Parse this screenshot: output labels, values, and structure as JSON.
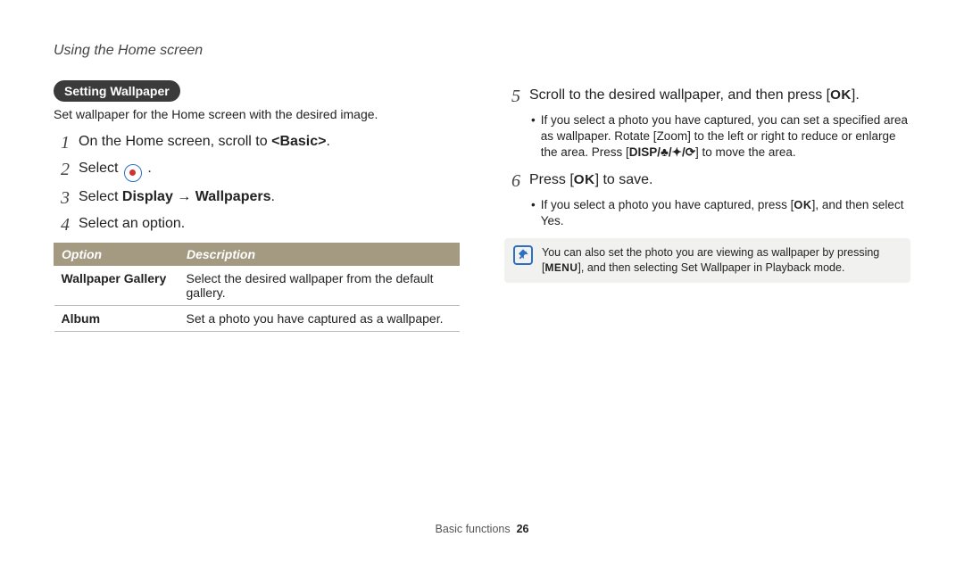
{
  "running_head": "Using the Home screen",
  "section_pill": "Setting Wallpaper",
  "intro": "Set wallpaper for the Home screen with the desired image.",
  "steps_left": {
    "s1_num": "1",
    "s1_a": "On the Home screen, scroll to ",
    "s1_b": "<Basic>",
    "s1_c": ".",
    "s2_num": "2",
    "s2_a": "Select ",
    "s2_b": " .",
    "s3_num": "3",
    "s3_a": "Select ",
    "s3_b": "Display",
    "s3_c": " → ",
    "s3_d": "Wallpapers",
    "s3_e": ".",
    "s4_num": "4",
    "s4_a": "Select an option."
  },
  "table": {
    "h1": "Option",
    "h2": "Description",
    "r1c1": "Wallpaper Gallery",
    "r1c2": "Select the desired wallpaper from the default gallery.",
    "r2c1": "Album",
    "r2c2": "Set a photo you have captured as a wallpaper."
  },
  "steps_right": {
    "s5_num": "5",
    "s5_a": "Scroll to the desired wallpaper, and then press [",
    "s5_ok": "OK",
    "s5_b": "].",
    "s5_bul1_a": "If you select a photo you have captured, you can set a specified area as wallpaper. Rotate [",
    "s5_bul1_zoom": "Zoom",
    "s5_bul1_b": "] to the left or right to reduce or enlarge the area. Press [",
    "s5_bul1_keys": "DISP/♣/✦/⟳",
    "s5_bul1_c": "] to move the area.",
    "s6_num": "6",
    "s6_a": "Press [",
    "s6_ok": "OK",
    "s6_b": "] to save.",
    "s6_bul1_a": "If you select a photo you have captured, press [",
    "s6_bul1_ok": "OK",
    "s6_bul1_b": "], and then select ",
    "s6_bul1_yes": "Yes",
    "s6_bul1_c": "."
  },
  "note": {
    "a": "You can also set the photo you are viewing as wallpaper by pressing [",
    "menu": "MENU",
    "b": "], and then selecting ",
    "setwp": "Set Wallpaper",
    "c": " in Playback mode."
  },
  "footer": {
    "section": "Basic functions",
    "page": "26"
  }
}
